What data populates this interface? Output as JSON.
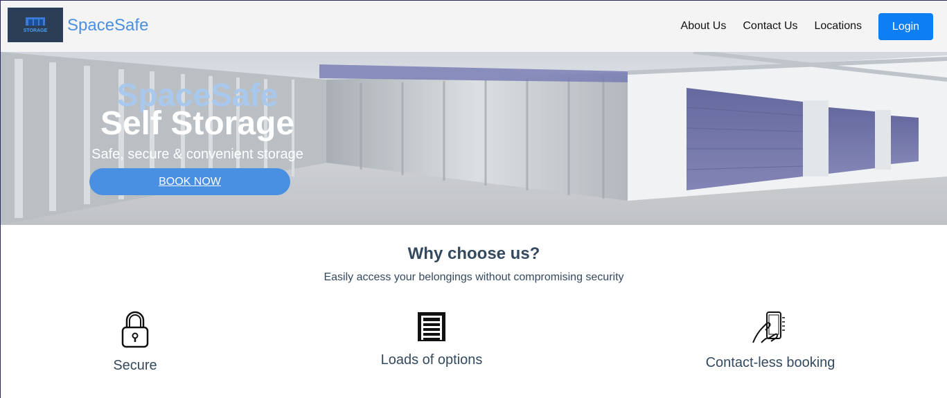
{
  "header": {
    "logo_text": "STORAGE",
    "brand": "SpaceSafe",
    "nav": [
      "About Us",
      "Contact Us",
      "Locations"
    ],
    "login_label": "Login"
  },
  "hero": {
    "brand": "SpaceSafe",
    "title": "Self Storage",
    "subtitle": "Safe, secure & convenient storage",
    "cta_label": "BOOK NOW"
  },
  "why": {
    "title": "Why choose us?",
    "subtitle": "Easily access your belongings without compromising security",
    "features": [
      {
        "icon": "padlock-icon",
        "label": "Secure"
      },
      {
        "icon": "storage-unit-icon",
        "label": "Loads of options"
      },
      {
        "icon": "phone-in-hand-icon",
        "label": "Contact-less booking"
      }
    ]
  },
  "colors": {
    "accent": "#4a90e2",
    "login": "#0d7ff2",
    "text_dark": "#34495e"
  }
}
